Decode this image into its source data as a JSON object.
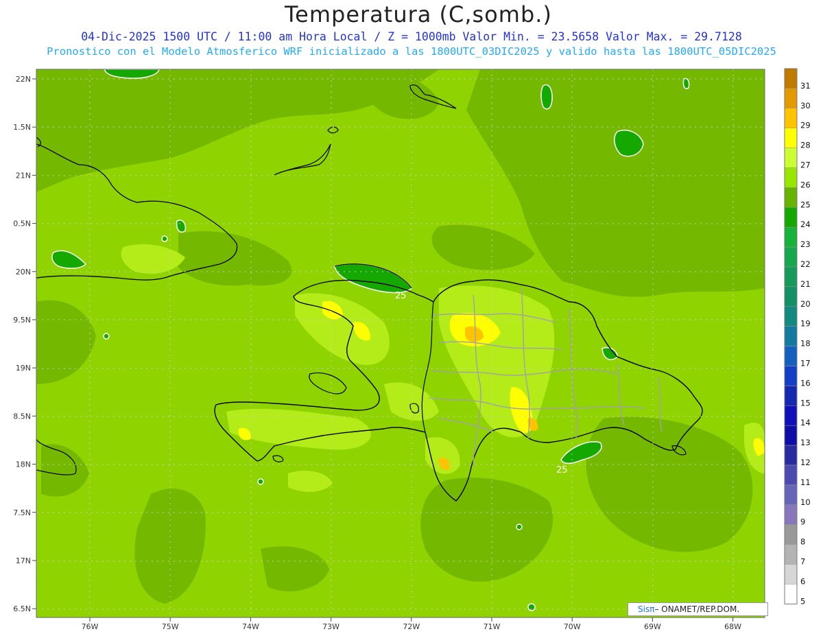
{
  "title": "Temperatura (C,somb.)",
  "subtitle_line1": "04-Dic-2025 1500 UTC / 11:00 am Hora Local / Z = 1000mb  Valor Min. = 23.5658  Valor Max. = 29.7128",
  "subtitle_line2": "Pronostico con el Modelo Atmosferico WRF inicializado a las 1800UTC_03DIC2025 y valido hasta las  1800UTC_05DIC2025",
  "stats": {
    "min": 23.5658,
    "max": 29.7128
  },
  "lat_labels": [
    "22N",
    "1.5N",
    "21N",
    "0.5N",
    "20N",
    "9.5N",
    "19N",
    "8.5N",
    "18N",
    "7.5N",
    "17N",
    "6.5N"
  ],
  "lon_labels": [
    "76W",
    "75W",
    "74W",
    "73W",
    "72W",
    "71W",
    "70W",
    "69W",
    "68W"
  ],
  "contour_labels": [
    "25",
    "25"
  ],
  "colorbar": {
    "values": [
      "31",
      "30",
      "29",
      "28",
      "27",
      "26",
      "25",
      "24",
      "23",
      "22",
      "21",
      "20",
      "19",
      "18",
      "17",
      "16",
      "15",
      "14",
      "13",
      "12",
      "11",
      "10",
      "9",
      "8",
      "7",
      "6",
      "5"
    ],
    "colors": [
      "#c17a00",
      "#e39a00",
      "#ffc400",
      "#ffff00",
      "#ccff33",
      "#99e600",
      "#66b300",
      "#14a800",
      "#16b23a",
      "#15a84e",
      "#169a5a",
      "#149066",
      "#138a80",
      "#137aa0",
      "#1460c0",
      "#1440c8",
      "#1428b0",
      "#1010b8",
      "#0d0da8",
      "#2a2aa0",
      "#4a4ab0",
      "#6666b8",
      "#8877bb",
      "#999999",
      "#b4b4b4",
      "#d6d6d6",
      "#ffffff"
    ]
  },
  "credit": {
    "brand": "Sis",
    "pi": "π",
    "text": "– ONAMET/REP.DOM."
  }
}
